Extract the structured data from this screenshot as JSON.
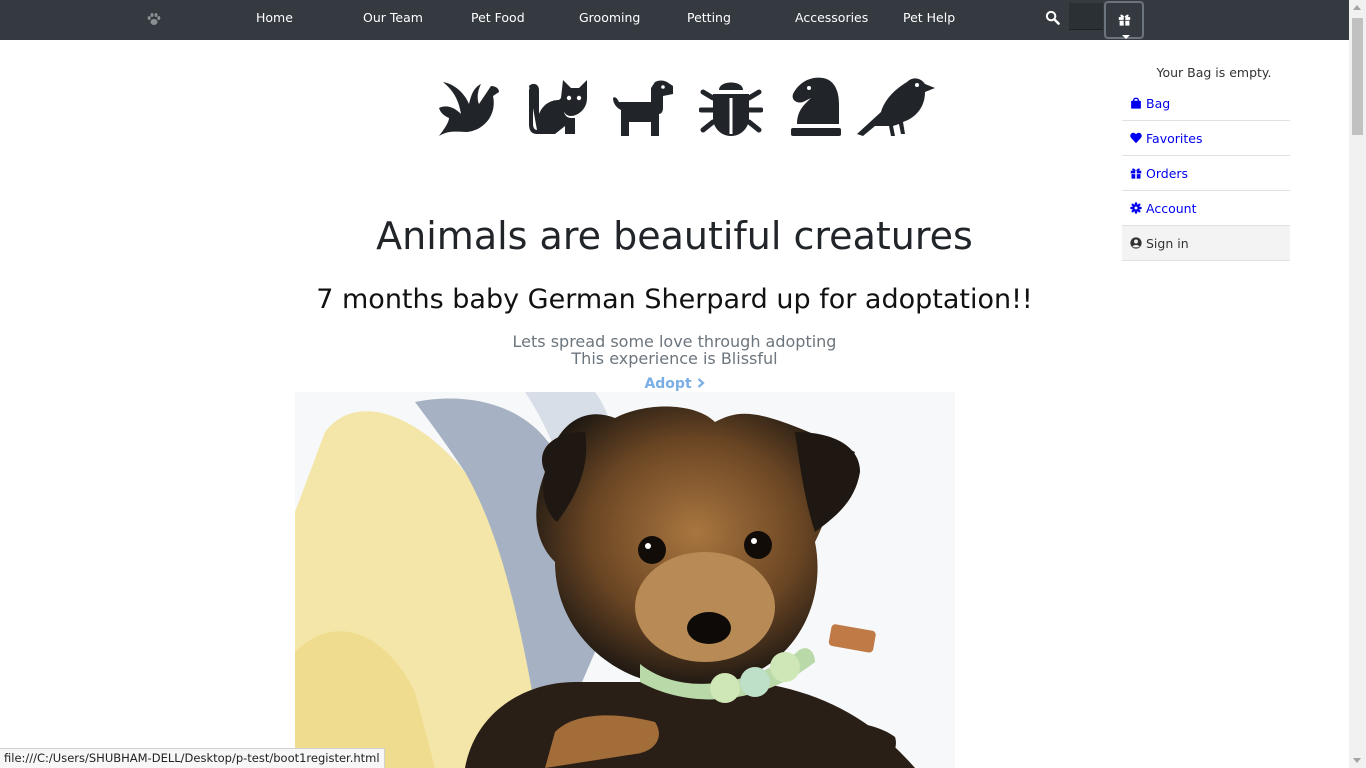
{
  "navbar": {
    "items": [
      {
        "label": "Home"
      },
      {
        "label": "Our Team"
      },
      {
        "label": "Pet Food"
      },
      {
        "label": "Grooming"
      },
      {
        "label": "Petting"
      },
      {
        "label": "Accessories"
      },
      {
        "label": "Pet Help"
      }
    ],
    "icons": [
      "paw-icon",
      "search-icon",
      "gift-icon"
    ]
  },
  "animal_icons": [
    "dove-icon",
    "cat-icon",
    "dog-icon",
    "bug-icon",
    "chess-knight-icon",
    "crow-icon"
  ],
  "main": {
    "title": "Animals are beautiful creatures",
    "subtitle": "7 months baby German Sherpard up for adoptation!!",
    "lead_line1": "Lets spread some love through adopting",
    "lead_line2": "This experience is Blissful",
    "adopt_label": "Adopt",
    "adopt_icon": "chevron-right-icon"
  },
  "bag_menu": {
    "empty_text": "Your Bag is empty.",
    "items": [
      {
        "label": "Bag",
        "icon": "shopping-bag-icon"
      },
      {
        "label": "Favorites",
        "icon": "heart-icon"
      },
      {
        "label": "Orders",
        "icon": "gift-icon"
      },
      {
        "label": "Account",
        "icon": "cog-icon"
      },
      {
        "label": "Sign in",
        "icon": "user-circle-icon"
      }
    ]
  },
  "status_bar": {
    "url": "file:///C:/Users/SHUBHAM-DELL/Desktop/p-test/boot1register.html"
  },
  "colors": {
    "navbar_bg": "#343a40",
    "link": "#0000ee",
    "adopt_link": "#7aaee5",
    "muted_text": "#6c757d"
  }
}
